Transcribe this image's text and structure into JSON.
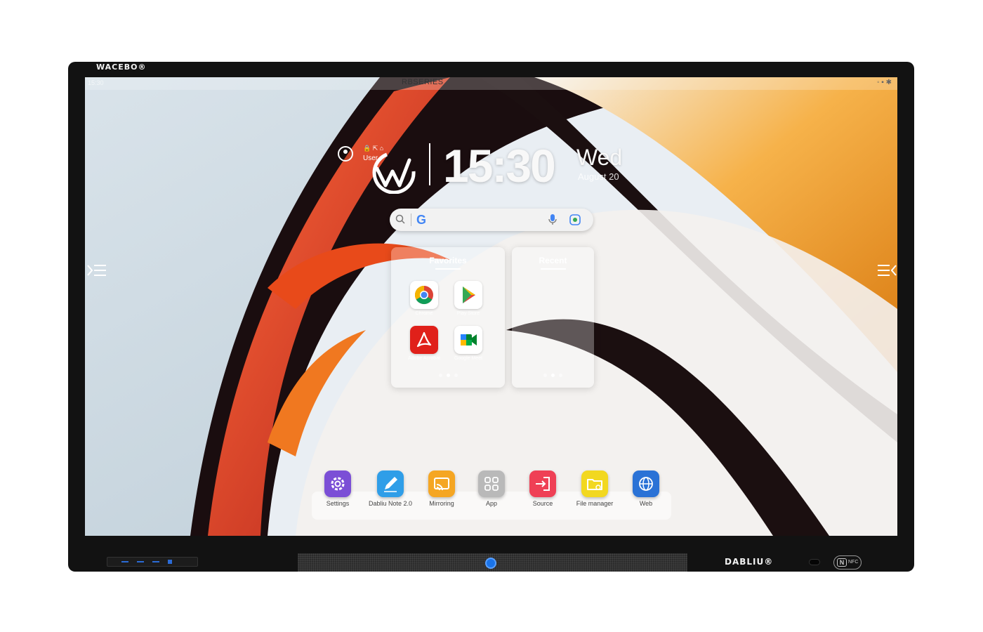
{
  "device": {
    "brand_top": "WACEBO®",
    "brand_bottom": "DABLIU®",
    "nfc_label": "NFC",
    "nfc_glyph": "N"
  },
  "status_bar": {
    "left_text": "15:30",
    "center_text": "RBSERIES",
    "right_text": "◦ ▪ ✱"
  },
  "home": {
    "user_label": "User",
    "mini_icons": "🔒 ⇱ ⌂",
    "time": "15:30",
    "day": "Wed",
    "date": "August 20"
  },
  "search": {
    "g_label": "G"
  },
  "favorites": {
    "title": "Favorites",
    "apps": [
      {
        "label": "Chrome",
        "icon": "chrome-icon"
      },
      {
        "label": "Play Store",
        "icon": "play-store-icon"
      },
      {
        "label": "Adobe Acrobat",
        "icon": "acrobat-icon"
      },
      {
        "label": "Google Meet",
        "icon": "meet-icon"
      }
    ],
    "page_count": 3,
    "active_page": 2
  },
  "recent": {
    "title": "Recent",
    "page_count": 3,
    "active_page": 2
  },
  "dock": {
    "apps": [
      {
        "label": "Settings",
        "icon": "settings-icon",
        "color": "#7b4fd6"
      },
      {
        "label": "Dabliu Note 2.0",
        "icon": "note-pen-icon",
        "color": "#2f9ee8"
      },
      {
        "label": "Mirroring",
        "icon": "mirroring-icon",
        "color": "#f5a623"
      },
      {
        "label": "App",
        "icon": "app-grid-icon",
        "color": "#b9b9b9"
      },
      {
        "label": "Source",
        "icon": "source-icon",
        "color": "#ef4055"
      },
      {
        "label": "File manager",
        "icon": "folder-icon",
        "color": "#f2d820"
      },
      {
        "label": "Web",
        "icon": "globe-icon",
        "color": "#2a72d6"
      }
    ]
  }
}
